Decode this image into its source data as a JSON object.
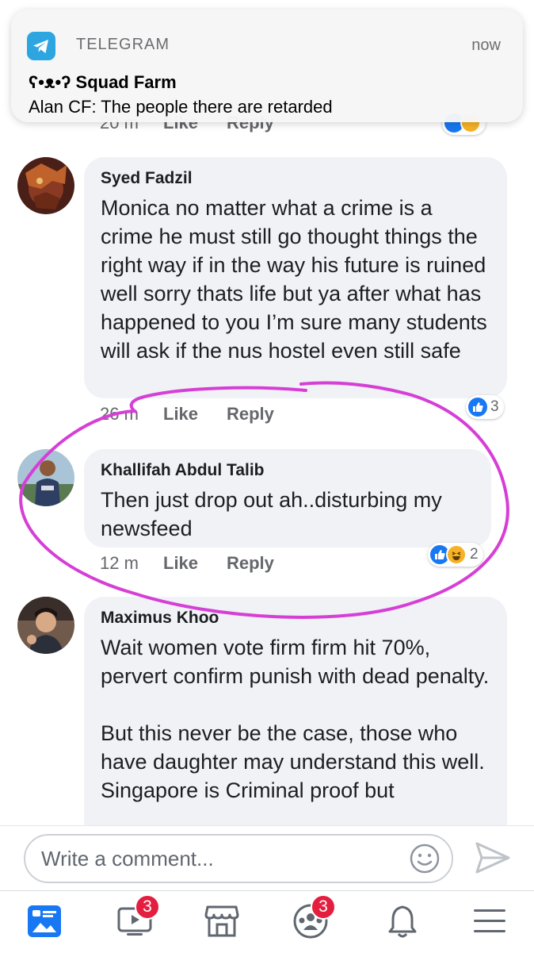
{
  "notification": {
    "app": "TELEGRAM",
    "time": "now",
    "title": "ʕ•ᴥ•ʔ Squad Farm",
    "body": "Alan CF: The people there are retarded"
  },
  "comments": [
    {
      "time": "20 m",
      "like_label": "Like",
      "reply_label": "Reply"
    },
    {
      "author": "Syed Fadzil",
      "text": "Monica no matter what a crime is a crime he must still go thought things the right way if in the way his future is ruined well sorry thats life but ya after what has happened to you I’m sure many students will ask if the nus hostel even still safe",
      "time": "26 m",
      "like_label": "Like",
      "reply_label": "Reply",
      "reaction_count": "3"
    },
    {
      "author": "Khallifah Abdul Talib",
      "text": "Then just drop out ah..disturbing my newsfeed",
      "time": "12 m",
      "like_label": "Like",
      "reply_label": "Reply",
      "reaction_count": "2"
    },
    {
      "author": "Maximus Khoo",
      "text": "Wait women vote firm firm hit 70%, pervert confirm punish with dead penalty.\n\nBut this never be the case, those who have daughter may understand this well. Singapore is Criminal proof but"
    }
  ],
  "composer": {
    "placeholder": "Write a comment..."
  },
  "tabbar": {
    "watch_badge": "3",
    "groups_badge": "3"
  },
  "colors": {
    "facebook_blue": "#1877f2",
    "badge_red": "#e41e3f",
    "annotation_magenta": "#d63fd6"
  }
}
